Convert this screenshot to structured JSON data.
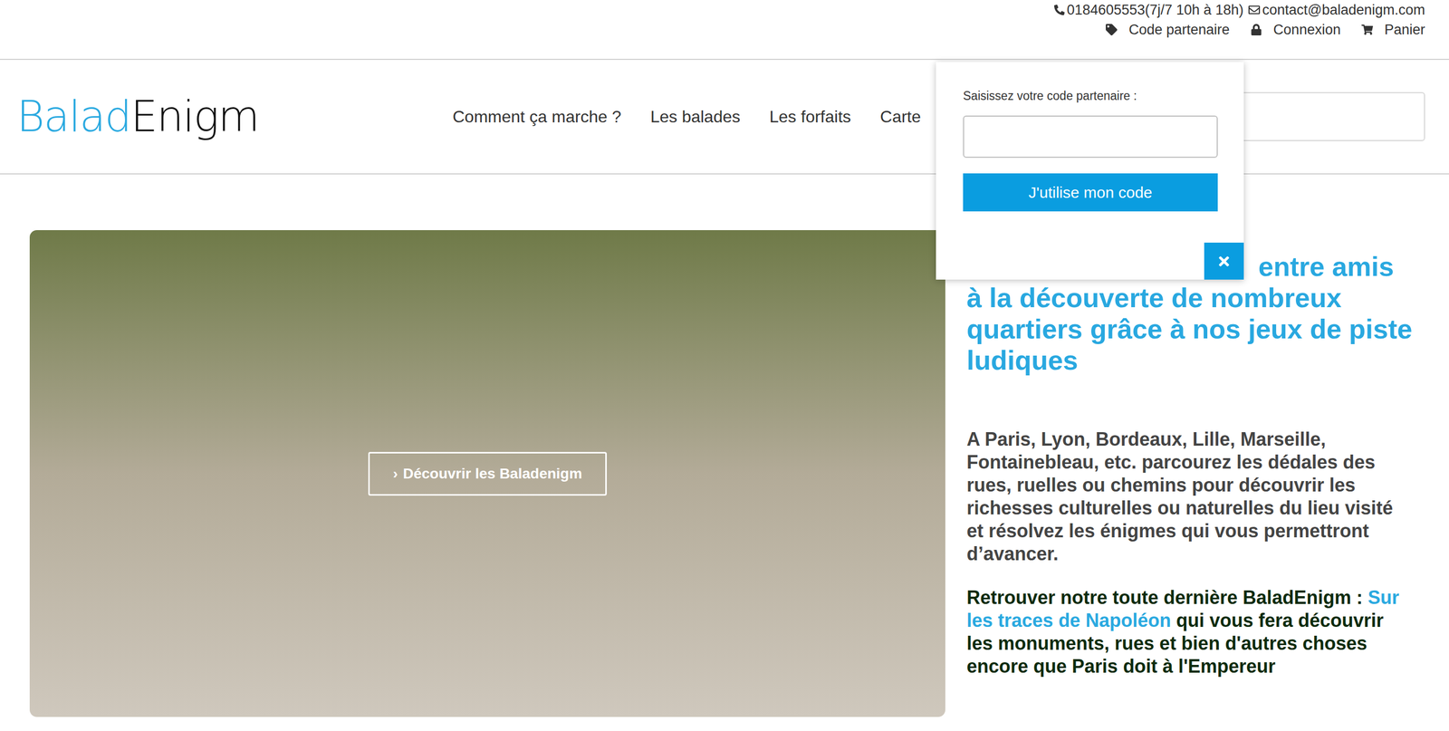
{
  "contact": {
    "phone": "0184605553(7j/7 10h à 18h)",
    "email": "contact@baladenigm.com"
  },
  "account_links": [
    {
      "label": "Code partenaire",
      "kind": "tag"
    },
    {
      "label": "Connexion",
      "kind": "lock"
    },
    {
      "label": "Panier",
      "kind": "cart"
    }
  ],
  "logo": {
    "part1": "Balad",
    "part2": "Enigm"
  },
  "nav": [
    "Comment ça marche ?",
    "Les balades",
    "Les forfaits",
    "Carte"
  ],
  "partner_popup": {
    "label": "Saisissez votre code partenaire :",
    "value": "",
    "button": "J'utilise mon code"
  },
  "hero": {
    "button_icon": "›",
    "button": "Découvrir les Baladenigm"
  },
  "intro": {
    "heading": "entre amis à la découverte de nombreux quartiers grâce à nos jeux de piste ludiques",
    "paragraph": "A Paris, Lyon, Bordeaux, Lille, Marseille, Fontainebleau, etc. parcourez les dédales des rues, ruelles ou chemins pour découvrir les richesses culturelles ou naturelles du lieu visité et résolvez les énigmes qui vous permettront d’avancer.",
    "latest_before": "Retrouver notre toute dernière BaladEnigm :",
    "latest_link": "Sur les traces de Napoléon",
    "latest_after": "qui vous fera découvrir les monuments, rues et bien d'autres choses encore que Paris doit à l'Empereur"
  }
}
